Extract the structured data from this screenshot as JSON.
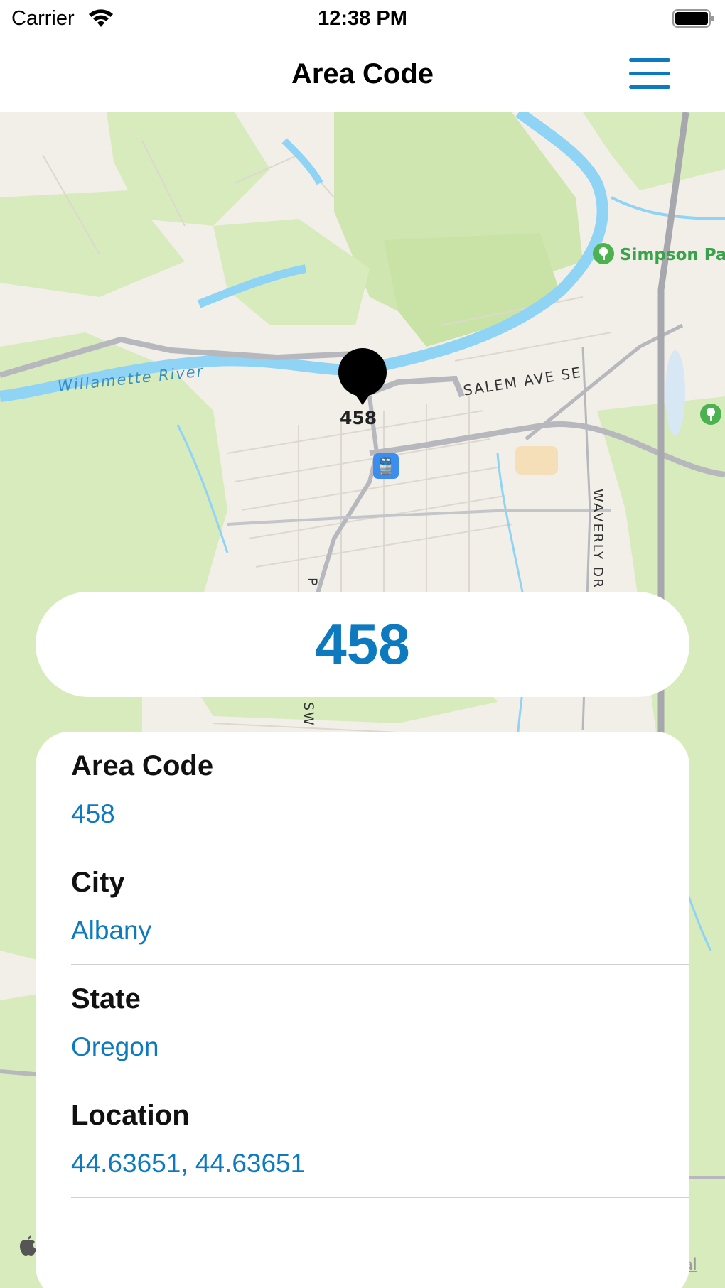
{
  "status_bar": {
    "carrier": "Carrier",
    "time": "12:38 PM"
  },
  "nav": {
    "title": "Area Code",
    "menu_icon": "hamburger-menu-icon"
  },
  "map": {
    "river_label": "Willamette River",
    "street_salem": "SALEM AVE SE",
    "street_waverly": "WAVERLY DR",
    "street_p": "P",
    "street_sw": "SW",
    "park_label": "Simpson Par",
    "pin_label": "458",
    "legal_link": "al",
    "transit_icon": "train-station-icon"
  },
  "highlight": {
    "code": "458"
  },
  "details": [
    {
      "label": "Area Code",
      "value": "458"
    },
    {
      "label": "City",
      "value": "Albany"
    },
    {
      "label": "State",
      "value": "Oregon"
    },
    {
      "label": "Location",
      "value": "44.63651, 44.63651"
    }
  ],
  "colors": {
    "accent": "#0d7ac0",
    "map_land": "#f2efe9",
    "map_green": "#d7ebbc",
    "water": "#8fd3f5"
  }
}
